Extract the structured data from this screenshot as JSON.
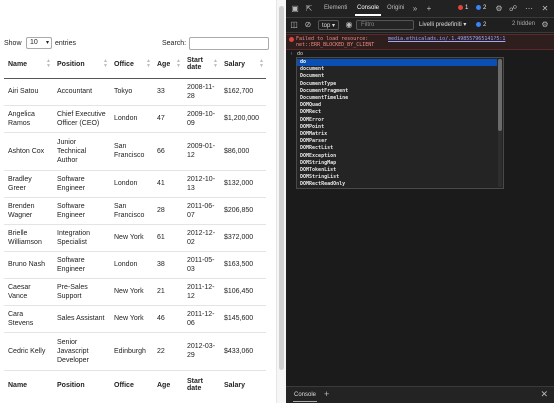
{
  "table_page": {
    "show_label": "Show",
    "entries_value": "10",
    "entries_label": "entries",
    "search_label": "Search:",
    "search_value": "",
    "columns": [
      "Name",
      "Position",
      "Office",
      "Age",
      "Start date",
      "Salary"
    ],
    "rows": [
      [
        "Airi Satou",
        "Accountant",
        "Tokyo",
        "33",
        "2008-11-28",
        "$162,700"
      ],
      [
        "Angelica Ramos",
        "Chief Executive Officer (CEO)",
        "London",
        "47",
        "2009-10-09",
        "$1,200,000"
      ],
      [
        "Ashton Cox",
        "Junior Technical Author",
        "San Francisco",
        "66",
        "2009-01-12",
        "$86,000"
      ],
      [
        "Bradley Greer",
        "Software Engineer",
        "London",
        "41",
        "2012-10-13",
        "$132,000"
      ],
      [
        "Brenden Wagner",
        "Software Engineer",
        "San Francisco",
        "28",
        "2011-06-07",
        "$206,850"
      ],
      [
        "Brielle Williamson",
        "Integration Specialist",
        "New York",
        "61",
        "2012-12-02",
        "$372,000"
      ],
      [
        "Bruno Nash",
        "Software Engineer",
        "London",
        "38",
        "2011-05-03",
        "$163,500"
      ],
      [
        "Caesar Vance",
        "Pre-Sales Support",
        "New York",
        "21",
        "2011-12-12",
        "$106,450"
      ],
      [
        "Cara Stevens",
        "Sales Assistant",
        "New York",
        "46",
        "2011-12-06",
        "$145,600"
      ],
      [
        "Cedric Kelly",
        "Senior Javascript Developer",
        "Edinburgh",
        "22",
        "2012-03-29",
        "$433,060"
      ]
    ]
  },
  "devtools": {
    "tabs": {
      "elements": "Elementi",
      "console": "Console",
      "sources": "Origini"
    },
    "badges": {
      "errors": "1",
      "issues": "2"
    },
    "toolbar": {
      "context": "top",
      "filter_placeholder": "Filtro",
      "levels": "Livelli predefiniti",
      "issues_count": "2",
      "hidden": "2 hidden"
    },
    "error": {
      "line1": "Failed to load resource:",
      "line2": "net::ERR_BLOCKED_BY_CLIENT",
      "link": "media.ethicalads.io/.1.498557965141?5:1"
    },
    "prompt_text": "do",
    "autocomplete": [
      "do",
      "document",
      "Document",
      "DocumentType",
      "DocumentFragment",
      "DocumentTimeline",
      "DOMQuad",
      "DOMRect",
      "DOMError",
      "DOMPoint",
      "DOMMatrix",
      "DOMParser",
      "DOMRectList",
      "DOMException",
      "DOMStringMap",
      "DOMTokenList",
      "DOMStringList",
      "DOMRectReadOnly"
    ],
    "drawer_tab": "Console",
    "colors": {
      "error": "#e0443c",
      "selection": "#0a4fb5",
      "link": "#9aa8ff"
    }
  }
}
